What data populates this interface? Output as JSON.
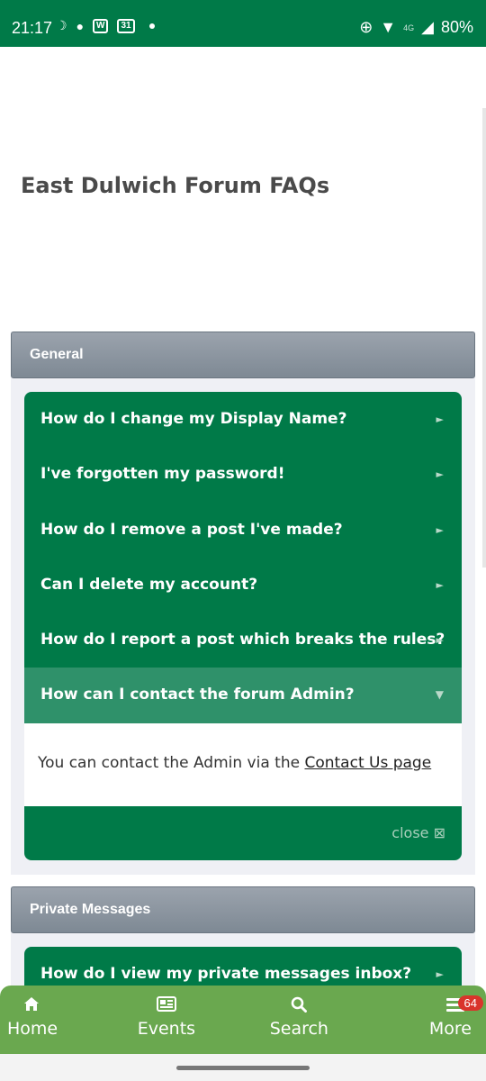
{
  "status_bar": {
    "time": "21:17",
    "w_badge": "W",
    "cal_badge": "31",
    "network": "4G",
    "battery": "80%"
  },
  "page": {
    "title": "East Dulwich Forum FAQs"
  },
  "sections": [
    {
      "title": "General",
      "items": [
        "How do I change my Display Name?",
        "I've forgotten my password!",
        "How do I remove a post I've made?",
        "Can I delete my account?",
        "How do I report a post which breaks the rules?",
        "How can I contact the forum Admin?"
      ],
      "open_item": {
        "answer_text": "You can contact the Admin via the ",
        "answer_link": "Contact Us page",
        "close_label": "close ⊠"
      }
    },
    {
      "title": "Private Messages",
      "items": [
        "How do I view my private messages inbox?"
      ]
    }
  ],
  "bottom_nav": {
    "home": "Home",
    "events": "Events",
    "search": "Search",
    "more": "More",
    "more_badge": "64"
  },
  "icons": {
    "arrow_collapsed": "►",
    "arrow_expanded": "▼",
    "home": "home-icon",
    "events": "newspaper-icon",
    "search": "search-icon",
    "more": "hamburger-icon"
  },
  "colors": {
    "status_bar": "#007a48",
    "faq_green": "#007a48",
    "faq_open": "#2f916a",
    "nav_green": "#6aa84f",
    "badge_red": "#d9342b"
  }
}
